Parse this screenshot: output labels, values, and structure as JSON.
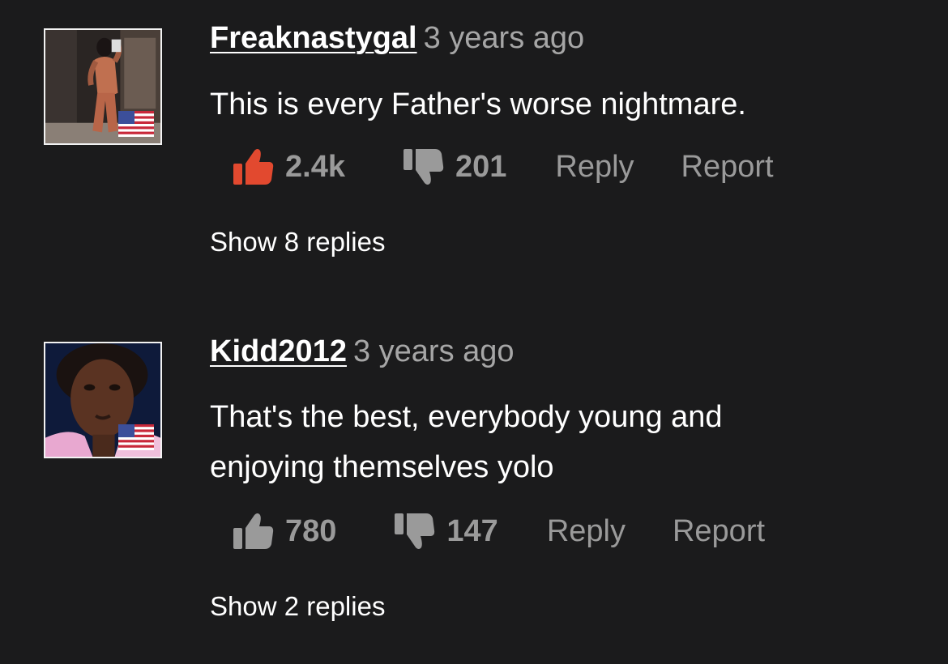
{
  "comments": [
    {
      "username": "Freaknastygal",
      "time": "3 years ago",
      "text": "This is every Father's worse nightmare.",
      "likes": "2.4k",
      "dislikes": "201",
      "liked": true,
      "reply_label": "Reply",
      "report_label": "Report",
      "show_replies": "Show 8 replies",
      "country_flag": "us-flag-icon"
    },
    {
      "username": "Kidd2012",
      "time": "3 years ago",
      "text": "That's the best, everybody young and enjoying themselves yolo",
      "likes": "780",
      "dislikes": "147",
      "liked": false,
      "reply_label": "Reply",
      "report_label": "Report",
      "show_replies": "Show 2 replies",
      "country_flag": "us-flag-icon"
    }
  ],
  "colors": {
    "background": "#1b1b1c",
    "like_active": "#e2492f",
    "muted": "#9a9a9a",
    "timestamp": "#a6a6a6",
    "text": "#ffffff"
  }
}
